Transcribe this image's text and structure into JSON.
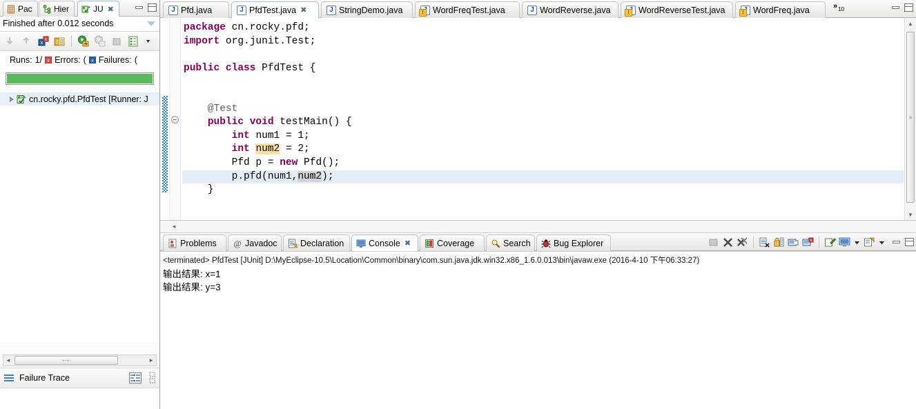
{
  "left_view": {
    "tabs": [
      {
        "label": "Pac",
        "icon": "package-explorer-icon",
        "active": false
      },
      {
        "label": "Hier",
        "icon": "type-hierarchy-icon",
        "active": false
      },
      {
        "label": "JU",
        "icon": "junit-icon",
        "active": true,
        "closable": true
      }
    ],
    "window_buttons": [
      "minimize",
      "maximize"
    ],
    "status_text": "Finished after 0.012 seconds",
    "view_menu_icon": "view-menu-caret-icon",
    "toolbar_icons": [
      "next-failure-icon",
      "previous-failure-icon",
      "show-failures-only-icon",
      "show-test-hierarchy-icon",
      "rerun-test-icon",
      "rerun-failed-tests-icon",
      "stop-test-run-icon",
      "test-run-history-icon",
      "view-menu-icon"
    ],
    "counters": {
      "runs_label": "Runs:",
      "runs_value": "1/",
      "errors_label": "Errors:",
      "errors_value": "(",
      "failures_label": "Failures:",
      "failures_value": "("
    },
    "progress": {
      "percent": 100,
      "color": "#5cb85c"
    },
    "tree": [
      {
        "label": "cn.rocky.pfd.PfdTest [Runner: J",
        "icon": "test-suite-pass-icon",
        "expandable": true,
        "selected": true
      }
    ],
    "hscroll": {
      "left_arrow": "◂",
      "right_arrow": "▸",
      "thumb_grip": "⋯"
    },
    "failure_trace": {
      "label": "Failure Trace",
      "icon": "failure-trace-icon",
      "actions": [
        "compare-result-icon",
        "filter-stack-trace-icon"
      ]
    }
  },
  "editor_area": {
    "tabs": [
      {
        "label": "Pfd.java",
        "icon": "java-file-icon",
        "active": false,
        "warning": false
      },
      {
        "label": "PfdTest.java",
        "icon": "java-file-icon",
        "active": true,
        "warning": false,
        "closable": true
      },
      {
        "label": "StringDemo.java",
        "icon": "java-file-icon",
        "active": false,
        "warning": false
      },
      {
        "label": "WordFreqTest.java",
        "icon": "java-file-warning-icon",
        "active": false,
        "warning": true
      },
      {
        "label": "WordReverse.java",
        "icon": "java-file-icon",
        "active": false,
        "warning": false
      },
      {
        "label": "WordReverseTest.java",
        "icon": "java-file-warning-icon",
        "active": false,
        "warning": true
      },
      {
        "label": "WordFreq.java",
        "icon": "java-file-warning-icon",
        "active": false,
        "warning": true
      }
    ],
    "overflow": {
      "chevrons": "»",
      "count": "10"
    },
    "window_buttons": [
      "minimize",
      "maximize"
    ],
    "code_lines": [
      {
        "tokens": [
          {
            "t": "package ",
            "c": "kw"
          },
          {
            "t": "cn.rocky.pfd;",
            "c": ""
          }
        ]
      },
      {
        "tokens": [
          {
            "t": "import ",
            "c": "kw"
          },
          {
            "t": "org.junit.Test;",
            "c": ""
          }
        ]
      },
      {
        "tokens": []
      },
      {
        "tokens": [
          {
            "t": "public class ",
            "c": "kw"
          },
          {
            "t": "PfdTest {",
            "c": ""
          }
        ]
      },
      {
        "tokens": []
      },
      {
        "tokens": []
      },
      {
        "tokens": [
          {
            "t": "    @Test",
            "c": "ann"
          }
        ]
      },
      {
        "tokens": [
          {
            "t": "    ",
            "c": ""
          },
          {
            "t": "public void ",
            "c": "kw"
          },
          {
            "t": "testMain() {",
            "c": ""
          }
        ]
      },
      {
        "tokens": [
          {
            "t": "        ",
            "c": ""
          },
          {
            "t": "int ",
            "c": "kw"
          },
          {
            "t": "num1 = 1;",
            "c": ""
          }
        ]
      },
      {
        "tokens": [
          {
            "t": "        ",
            "c": ""
          },
          {
            "t": "int ",
            "c": "kw"
          },
          {
            "t": "num2",
            "c": "hl-decl"
          },
          {
            "t": " = 2;",
            "c": ""
          }
        ]
      },
      {
        "tokens": [
          {
            "t": "        Pfd p = ",
            "c": ""
          },
          {
            "t": "new ",
            "c": "kw"
          },
          {
            "t": "Pfd();",
            "c": ""
          }
        ]
      },
      {
        "tokens": [
          {
            "t": "        p.pfd(num1,",
            "c": ""
          },
          {
            "t": "num2",
            "c": "hl-occ"
          },
          {
            "t": ");",
            "c": ""
          }
        ],
        "current": true
      },
      {
        "tokens": [
          {
            "t": "    }",
            "c": ""
          }
        ]
      },
      {
        "tokens": []
      },
      {
        "tokens": []
      },
      {
        "tokens": [
          {
            "t": "}",
            "c": ""
          }
        ]
      }
    ],
    "vscroll": {
      "up": "▲",
      "down": "▼",
      "grip": "≡"
    },
    "hscroll": {
      "left_arrow": "◂"
    }
  },
  "bottom_view": {
    "tabs": [
      {
        "label": "Problems",
        "icon": "problems-icon",
        "active": false
      },
      {
        "label": "Javadoc",
        "icon": "javadoc-icon",
        "active": false
      },
      {
        "label": "Declaration",
        "icon": "declaration-icon",
        "active": false
      },
      {
        "label": "Console",
        "icon": "console-icon",
        "active": true,
        "closable": true
      },
      {
        "label": "Coverage",
        "icon": "coverage-icon",
        "active": false
      },
      {
        "label": "Search",
        "icon": "search-icon",
        "active": false
      },
      {
        "label": "Bug Explorer",
        "icon": "bug-explorer-icon",
        "active": false
      }
    ],
    "toolbar_icons": [
      "terminate-icon",
      "remove-launch-icon",
      "remove-all-terminated-icon",
      "clear-console-icon",
      "scroll-lock-icon",
      "show-console-on-output-icon",
      "show-console-on-error-icon",
      "pin-console-icon",
      "display-selected-console-icon",
      "display-selected-console-dropdown-icon",
      "open-console-icon",
      "open-console-dropdown-icon"
    ],
    "window_buttons": [
      "minimize",
      "maximize"
    ],
    "console": {
      "header": "<terminated> PfdTest [JUnit] D:\\MyEclipse-10.5\\Location\\Common\\binary\\com.sun.java.jdk.win32.x86_1.6.0.013\\bin\\javaw.exe (2016-4-10 下午06:33:27)",
      "lines": [
        "输出结果: x=1",
        "输出结果: y=3"
      ]
    }
  }
}
